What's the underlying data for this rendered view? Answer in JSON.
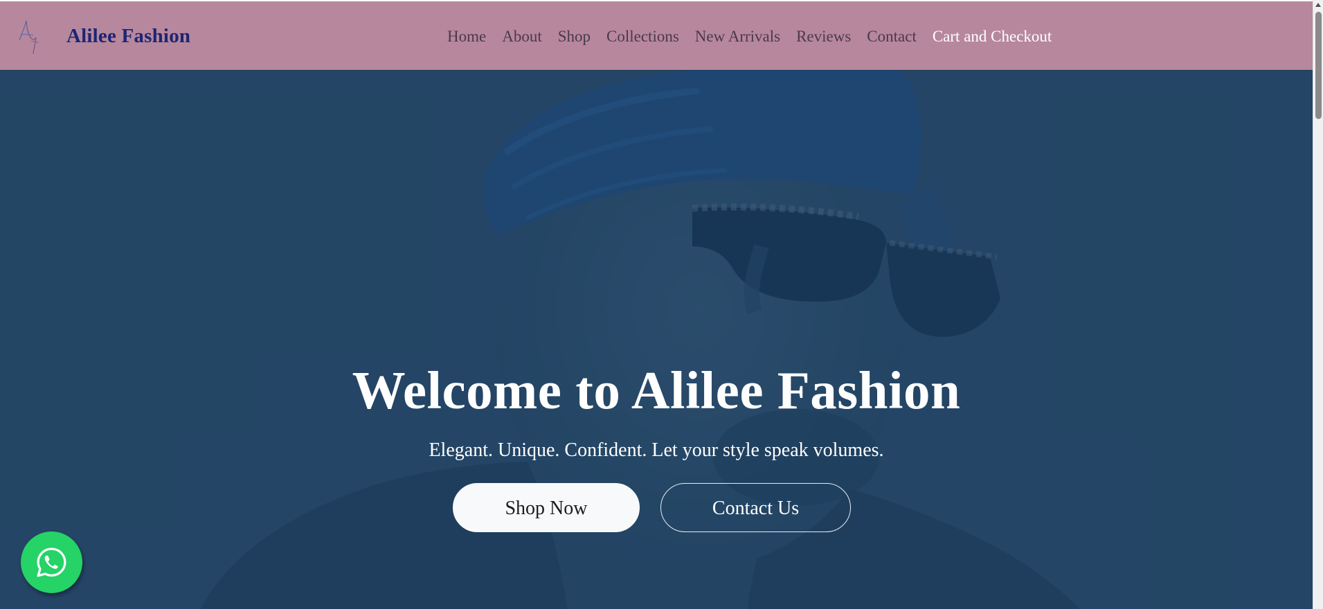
{
  "brand": {
    "name": "Alilee Fashion",
    "logo_icon": "signature-logo-icon"
  },
  "nav": {
    "items": [
      {
        "label": "Home"
      },
      {
        "label": "About"
      },
      {
        "label": "Shop"
      },
      {
        "label": "Collections"
      },
      {
        "label": "New Arrivals"
      },
      {
        "label": "Reviews"
      },
      {
        "label": "Contact"
      },
      {
        "label": "Cart and Checkout"
      }
    ],
    "active_color": "#ffffff",
    "link_color": "#4a3a48"
  },
  "hero": {
    "title": "Welcome to Alilee Fashion",
    "subtitle": "Elegant. Unique. Confident. Let your style speak volumes.",
    "primary_button": "Shop Now",
    "secondary_button": "Contact Us",
    "overlay_color": "#1f4060"
  },
  "floating": {
    "whatsapp_icon": "whatsapp-icon",
    "color": "#25d366"
  },
  "colors": {
    "navbar": "#b7879d",
    "brand_text": "#1b2674",
    "hero_background": "#2b4b66"
  }
}
